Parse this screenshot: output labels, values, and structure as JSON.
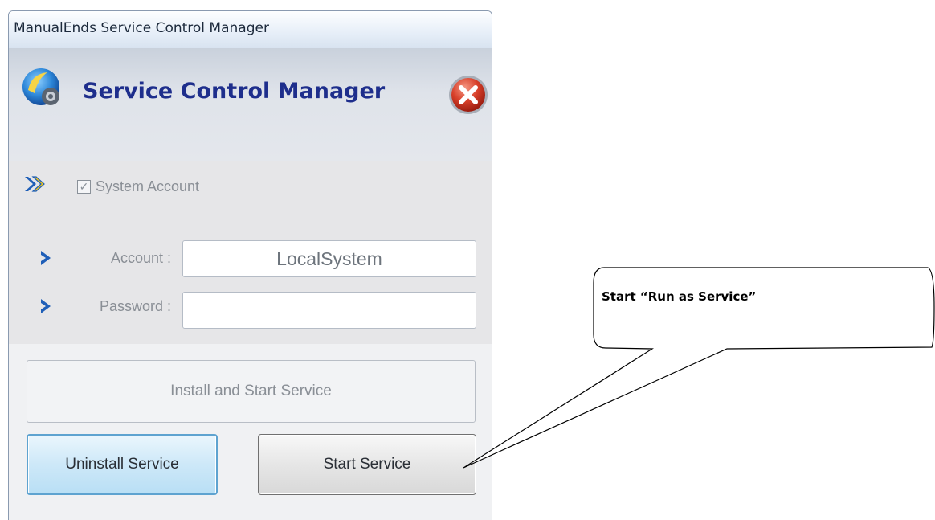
{
  "window": {
    "title": "ManualEnds Service Control Manager"
  },
  "header": {
    "title": "Service Control Manager"
  },
  "system_account": {
    "label": "System Account",
    "checked": true
  },
  "account": {
    "label": "Account :",
    "value": "LocalSystem"
  },
  "password": {
    "label": "Password :",
    "value": ""
  },
  "buttons": {
    "install": "Install and Start Service",
    "uninstall": "Uninstall Service",
    "start": "Start Service"
  },
  "callout": {
    "text": "Start “Run as Service”"
  },
  "colors": {
    "header_title": "#1e2e8c",
    "arrow_blue": "#1f5fb8",
    "arrow_yellow": "#f0c419",
    "close_red": "#d8402a"
  }
}
